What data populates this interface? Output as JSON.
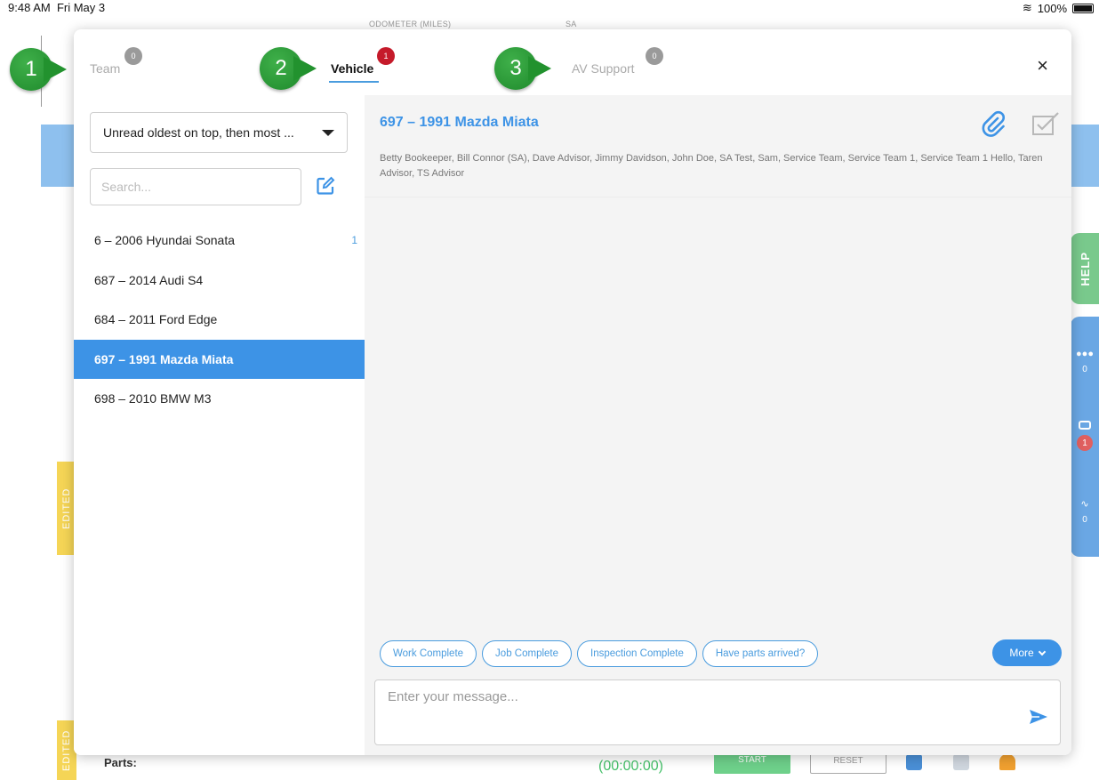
{
  "status_bar": {
    "time": "9:48 AM",
    "date": "Fri May 3",
    "battery": "100%"
  },
  "background": {
    "odometer_caption": "ODOMETER (MILES)",
    "sa_caption": "SA",
    "edited_label_1": "EDITED",
    "edited_label_2": "EDITED",
    "parts_label": "Parts:",
    "timer": "(00:00:00)",
    "start_label": "START",
    "reset_label": "RESET",
    "help_label": "HELP",
    "rail_team_count": "0",
    "rail_vehicle_count": "1",
    "rail_support_count": "0"
  },
  "tabs": [
    {
      "label": "Team",
      "badge": "0"
    },
    {
      "label": "Vehicle",
      "badge": "1"
    },
    {
      "label": "AV Support",
      "badge": "0"
    }
  ],
  "close_label": "×",
  "sidebar": {
    "sort_value": "Unread oldest on top, then most ...",
    "search_placeholder": "Search...",
    "conversations": [
      {
        "label": "6 – 2006 Hyundai Sonata",
        "count": "1"
      },
      {
        "label": "687 – 2014 Audi S4",
        "count": ""
      },
      {
        "label": "684 – 2011 Ford Edge",
        "count": ""
      },
      {
        "label": "697 – 1991 Mazda Miata",
        "count": ""
      },
      {
        "label": "698 – 2010 BMW M3",
        "count": ""
      }
    ]
  },
  "conversation": {
    "title": "697 – 1991 Mazda Miata",
    "participants": "Betty Bookeeper, Bill Connor (SA), Dave Advisor, Jimmy Davidson, John Doe, SA Test, Sam, Service Team, Service Team 1, Service Team 1 Hello, Taren Advisor, TS Advisor"
  },
  "quick_replies": [
    "Work Complete",
    "Job Complete",
    "Inspection Complete",
    "Have parts arrived?"
  ],
  "more_label": "More",
  "message_placeholder": "Enter your message...",
  "callouts": [
    "1",
    "2",
    "3"
  ],
  "colors": {
    "accent": "#3d93e6",
    "badge_red": "#c51a2a",
    "callout_green": "#22922e"
  }
}
